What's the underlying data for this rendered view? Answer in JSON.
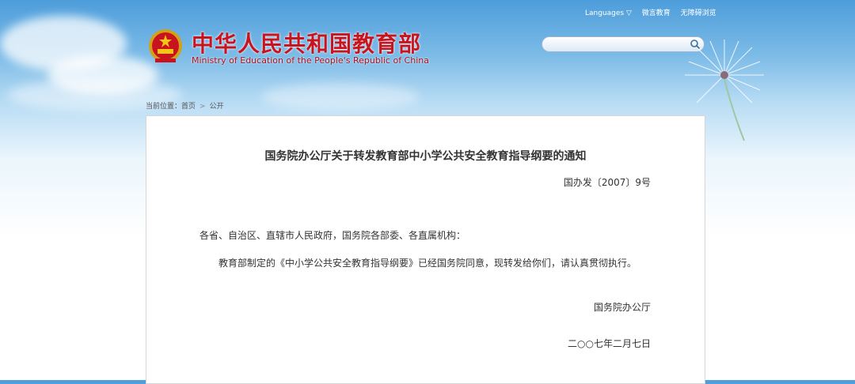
{
  "header": {
    "title_cn": "中华人民共和国教育部",
    "title_en": "Ministry of Education of the People's Republic of China",
    "links": {
      "languages": "Languages ▽",
      "weibo": "微言教育",
      "accessible": "无障碍浏览"
    },
    "search": {
      "placeholder": "",
      "value": ""
    },
    "colors": {
      "brand_red": "#c8141e",
      "sky_blue": "#4d9ddb"
    }
  },
  "breadcrumb": {
    "prefix": "当前位置：",
    "home": "首页",
    "separator": ">",
    "current": "公开"
  },
  "document": {
    "title": "国务院办公厅关于转发教育部中小学公共安全教育指导纲要的通知",
    "number": "国办发〔2007〕9号",
    "salutation": "各省、自治区、直辖市人民政府，国务院各部委、各直属机构：",
    "body": "教育部制定的《中小学公共安全教育指导纲要》已经国务院同意，现转发给你们，请认真贯彻执行。",
    "signature": "国务院办公厅",
    "date": "二○○七年二月七日"
  }
}
